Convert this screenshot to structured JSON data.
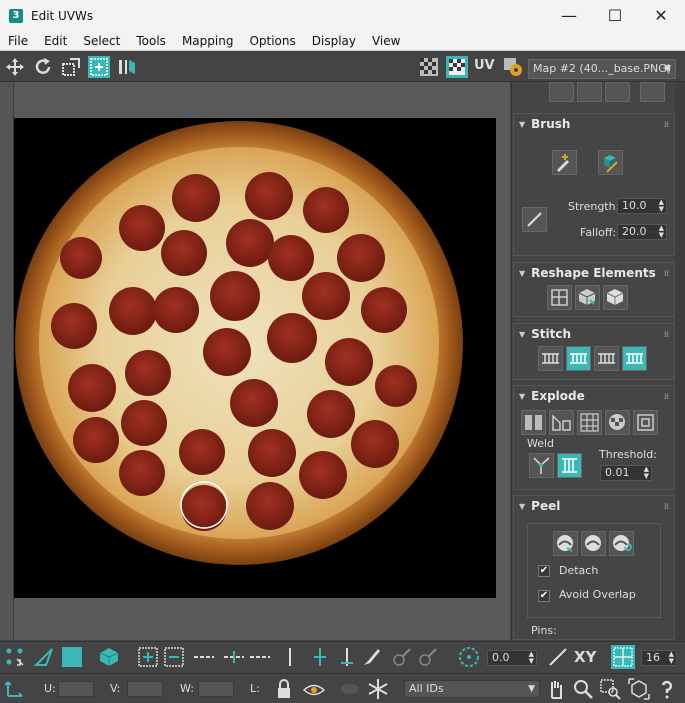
{
  "window": {
    "title": "Edit UVWs",
    "app_icon": "3"
  },
  "menu": [
    "File",
    "Edit",
    "Select",
    "Tools",
    "Mapping",
    "Options",
    "Display",
    "View"
  ],
  "toolbar": {
    "uv_label": "UV",
    "map_select": "Map #2 (40..._base.PNG)"
  },
  "brush": {
    "title": "Brush",
    "strength_label": "Strength:",
    "strength_value": "10.0",
    "falloff_label": "Falloff:",
    "falloff_value": "20.0"
  },
  "reshape": {
    "title": "Reshape Elements"
  },
  "stitch": {
    "title": "Stitch"
  },
  "explode": {
    "title": "Explode",
    "weld_label": "Weld",
    "threshold_label": "Threshold:",
    "threshold_value": "0.01"
  },
  "peel": {
    "title": "Peel",
    "detach_label": "Detach",
    "detach_checked": true,
    "avoid_overlap_label": "Avoid Overlap",
    "avoid_overlap_checked": true,
    "pins_label": "Pins:"
  },
  "bottom1": {
    "angle_value": "0.0",
    "xy_label": "XY",
    "count_value": "16"
  },
  "bottom2": {
    "u_label": "U:",
    "v_label": "V:",
    "w_label": "W:",
    "l_label": "L:",
    "ids_select": "All IDs"
  },
  "colors": {
    "accent": "#3ab8b8",
    "panel": "#444444",
    "canvas": "#000000"
  }
}
